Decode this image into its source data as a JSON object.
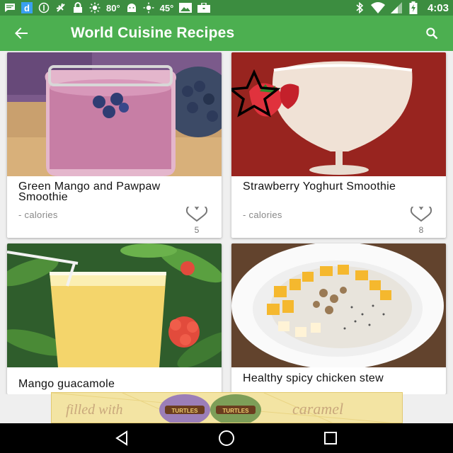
{
  "status_bar": {
    "icons_left": [
      "message-icon",
      "d-app-icon",
      "compass-icon",
      "usb-icon",
      "lock-icon",
      "sun-icon",
      "android-icon",
      "sun-icon",
      "image-icon",
      "briefcase-icon"
    ],
    "temp_1": "80°",
    "temp_2": "45°",
    "icons_right": [
      "bluetooth-icon",
      "wifi-icon",
      "signal-icon",
      "battery-charging-icon"
    ],
    "time": "4:03"
  },
  "app_bar": {
    "title": "World Cuisine Recipes",
    "back_icon": "arrow-back-icon",
    "search_icon": "search-icon",
    "color": "#4caf50",
    "status_color": "#3c8d40"
  },
  "recipes": [
    {
      "title": "Green Mango and Pawpaw Smoothie",
      "calories": "- calories",
      "favorites": "5",
      "image": "blueberry-smoothie-jar"
    },
    {
      "title": "Strawberry Yoghurt Smoothie",
      "calories": "- calories",
      "favorites": "8",
      "image": "strawberry-glass",
      "starred": true
    },
    {
      "title": "Mango guacamole",
      "image": "juice-glass"
    },
    {
      "title": "Healthy spicy chicken stew",
      "image": "fruit-bowl"
    }
  ],
  "ad": {
    "text_left": "filled with",
    "brand": "TURTLES",
    "text_right": "caramel"
  },
  "nav_bar": {
    "buttons": [
      "back-triangle-icon",
      "home-circle-icon",
      "recents-square-icon"
    ]
  }
}
